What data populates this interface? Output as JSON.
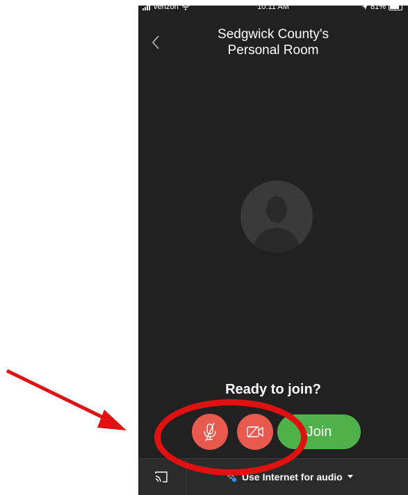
{
  "status_bar": {
    "carrier": "Verizon",
    "time": "10:11 AM",
    "battery": "81%"
  },
  "header": {
    "title_line1": "Sedgwick County's",
    "title_line2": "Personal Room"
  },
  "main": {
    "ready_text": "Ready to join?",
    "join_label": "Join"
  },
  "bottom_bar": {
    "audio_label": "Use Internet for audio"
  },
  "colors": {
    "background": "#212121",
    "mute_button": "#e8594e",
    "join_button": "#4fb14a",
    "annotation": "#e01111"
  },
  "icons": [
    "back-chevron-icon",
    "avatar-silhouette-icon",
    "mic-off-icon",
    "video-off-icon",
    "cast-icon",
    "wifi-audio-icon",
    "caret-down-icon"
  ]
}
